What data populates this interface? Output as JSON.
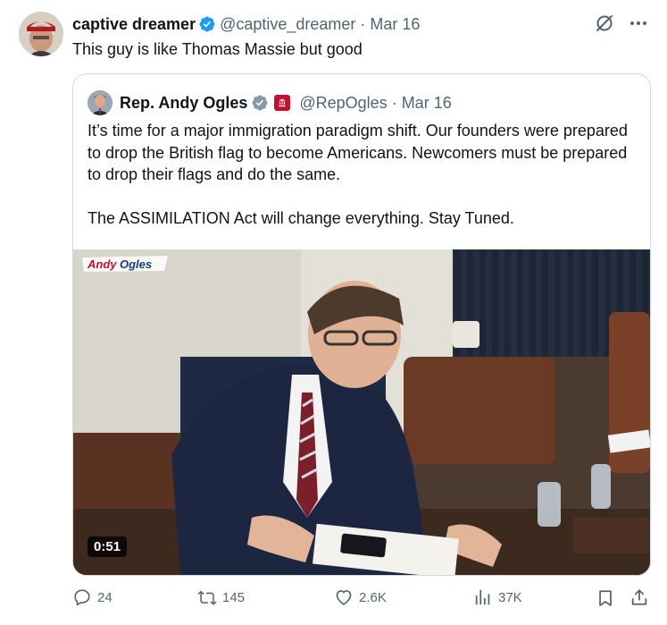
{
  "post": {
    "author_name": "captive dreamer",
    "author_handle": "@captive_dreamer",
    "separator": "·",
    "date": "Mar 16",
    "text": "This guy is like Thomas Massie but good"
  },
  "quoted": {
    "author_name": "Rep. Andy Ogles",
    "author_handle": "@RepOgles",
    "separator": "·",
    "date": "Mar 16",
    "paragraph1": "It’s time for a major immigration paradigm shift. Our founders were prepared to drop the British flag to become Americans. Newcomers must be prepared to drop their flags and do the same.",
    "paragraph2": "The ASSIMILATION Act will change everything. Stay Tuned.",
    "video_duration": "0:51",
    "watermark_text": "Andy Ogles"
  },
  "actions": {
    "replies": "24",
    "reposts": "145",
    "likes": "2.6K",
    "views": "37K"
  },
  "icons": [
    "verified-icon",
    "grok-icon",
    "more-icon",
    "government-affiliate-icon",
    "reply-icon",
    "repost-icon",
    "like-icon",
    "views-icon",
    "bookmark-icon",
    "share-icon"
  ],
  "colors": {
    "text": "#0f1419",
    "secondary": "#536471",
    "verified": "#1d9bf0",
    "border": "#cfd9de",
    "affiliate": "#c8102e"
  }
}
